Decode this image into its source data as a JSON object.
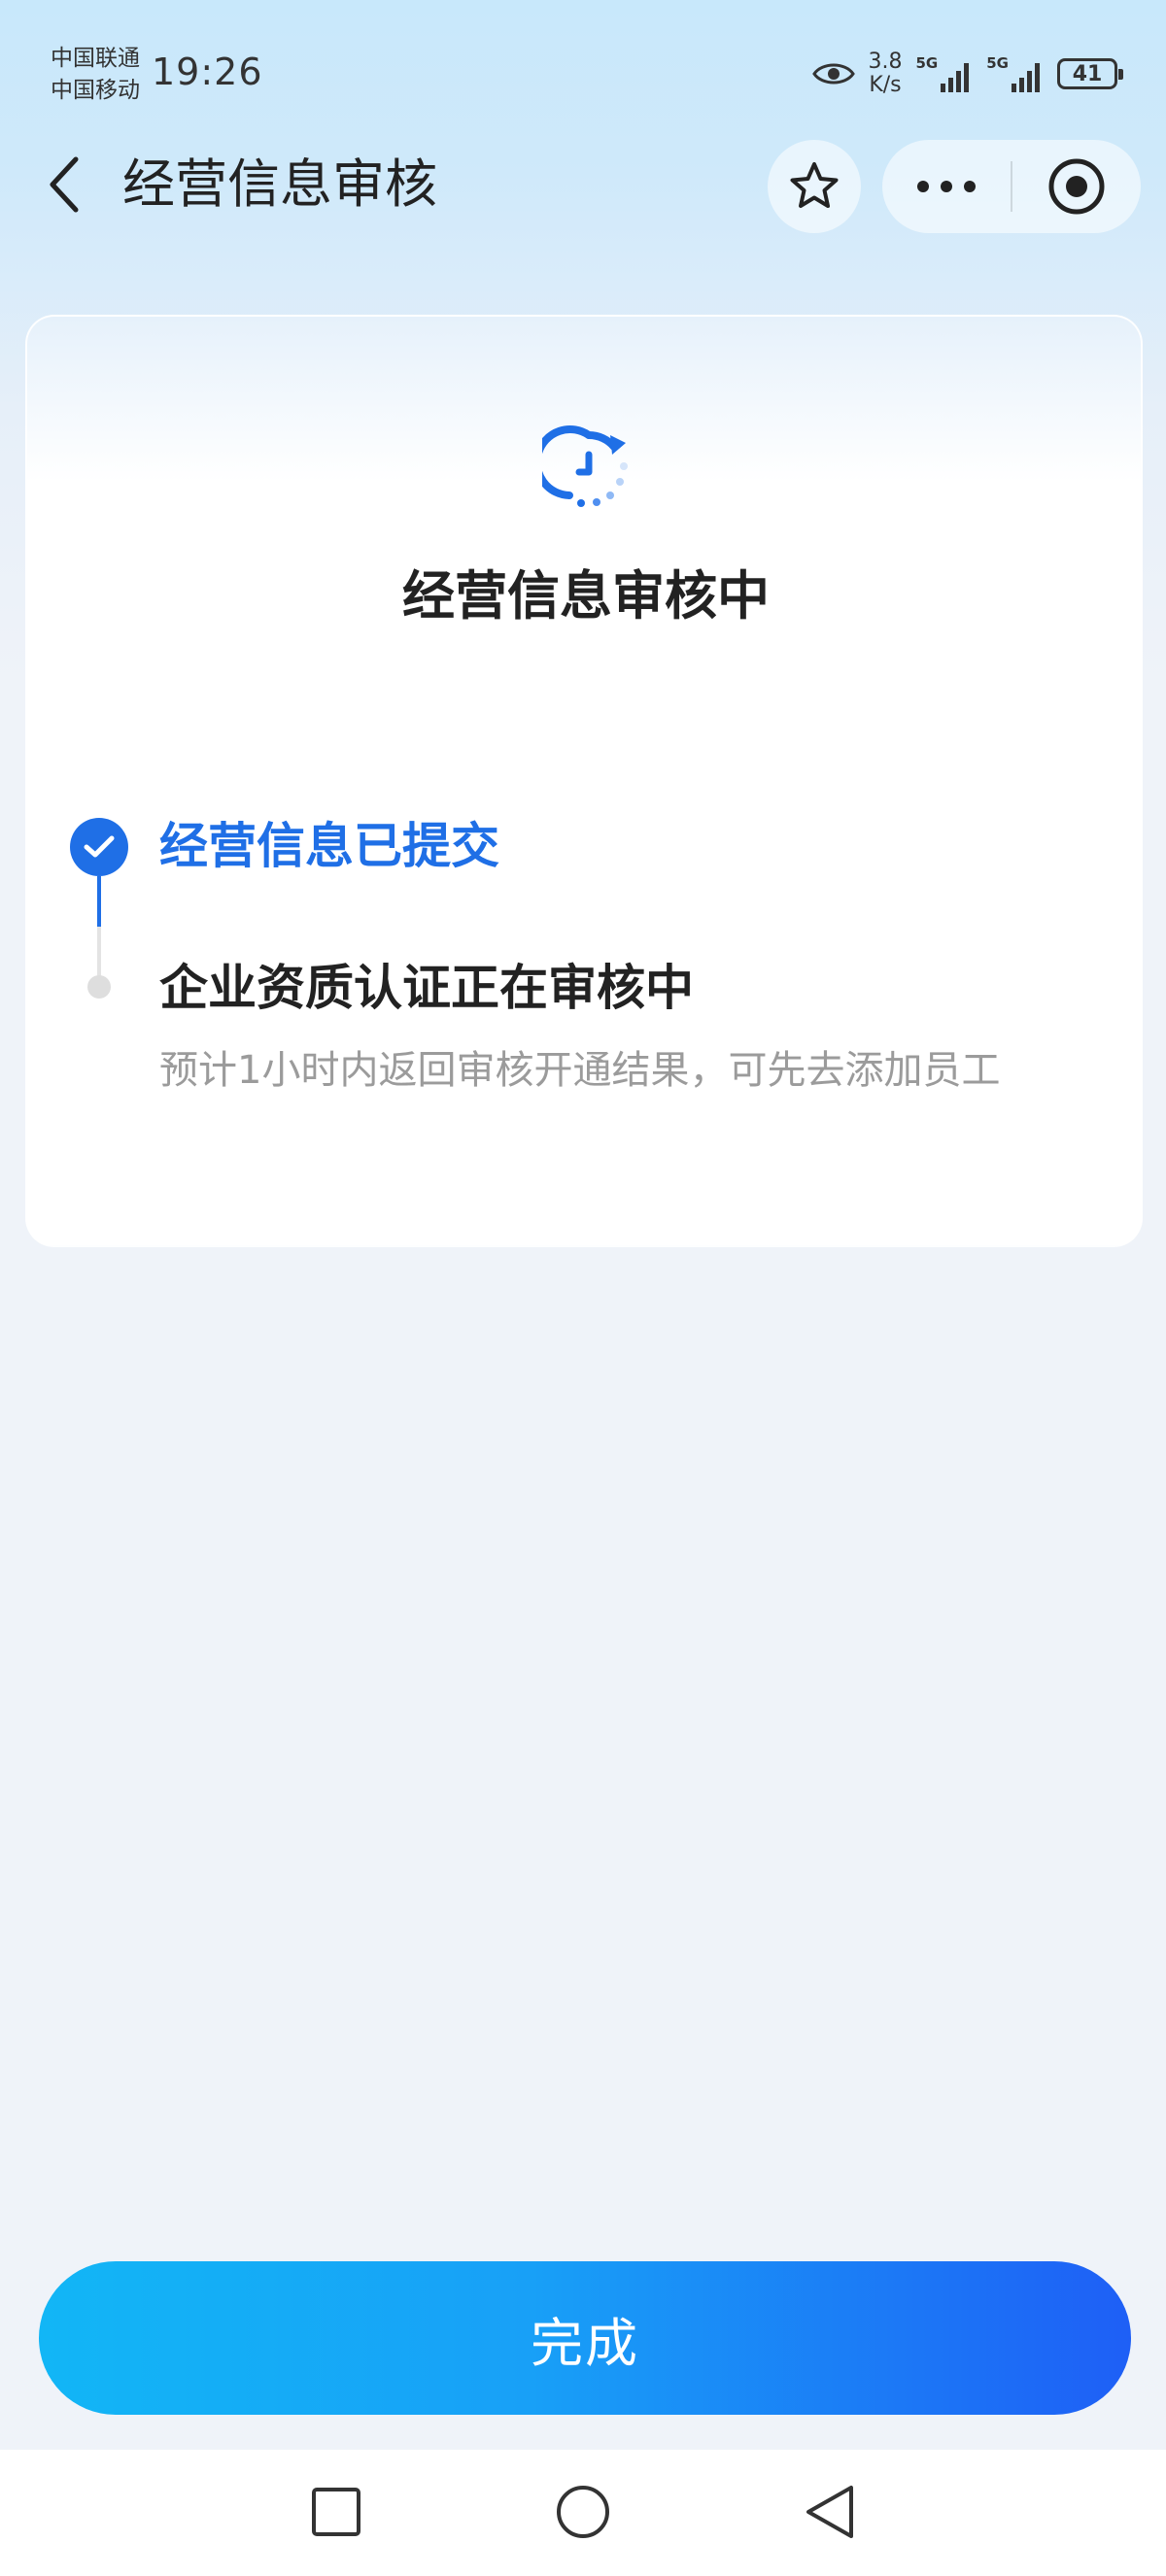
{
  "status_bar": {
    "carrier_1": "中国联通",
    "carrier_2": "中国移动",
    "time": "19:26",
    "net_speed_value": "3.8",
    "net_speed_unit": "K/s",
    "signal_1_label": "5G",
    "signal_2_label": "5G",
    "battery": "41"
  },
  "nav": {
    "title": "经营信息审核"
  },
  "card": {
    "title": "经营信息审核中",
    "steps": [
      {
        "label": "经营信息已提交"
      },
      {
        "label": "企业资质认证正在审核中",
        "description": "预计1小时内返回审核开通结果，可先去添加员工"
      }
    ]
  },
  "actions": {
    "done_label": "完成"
  },
  "colors": {
    "accent": "#1f6fe6",
    "button_start": "#12b6f6",
    "button_end": "#1e5ff6"
  }
}
